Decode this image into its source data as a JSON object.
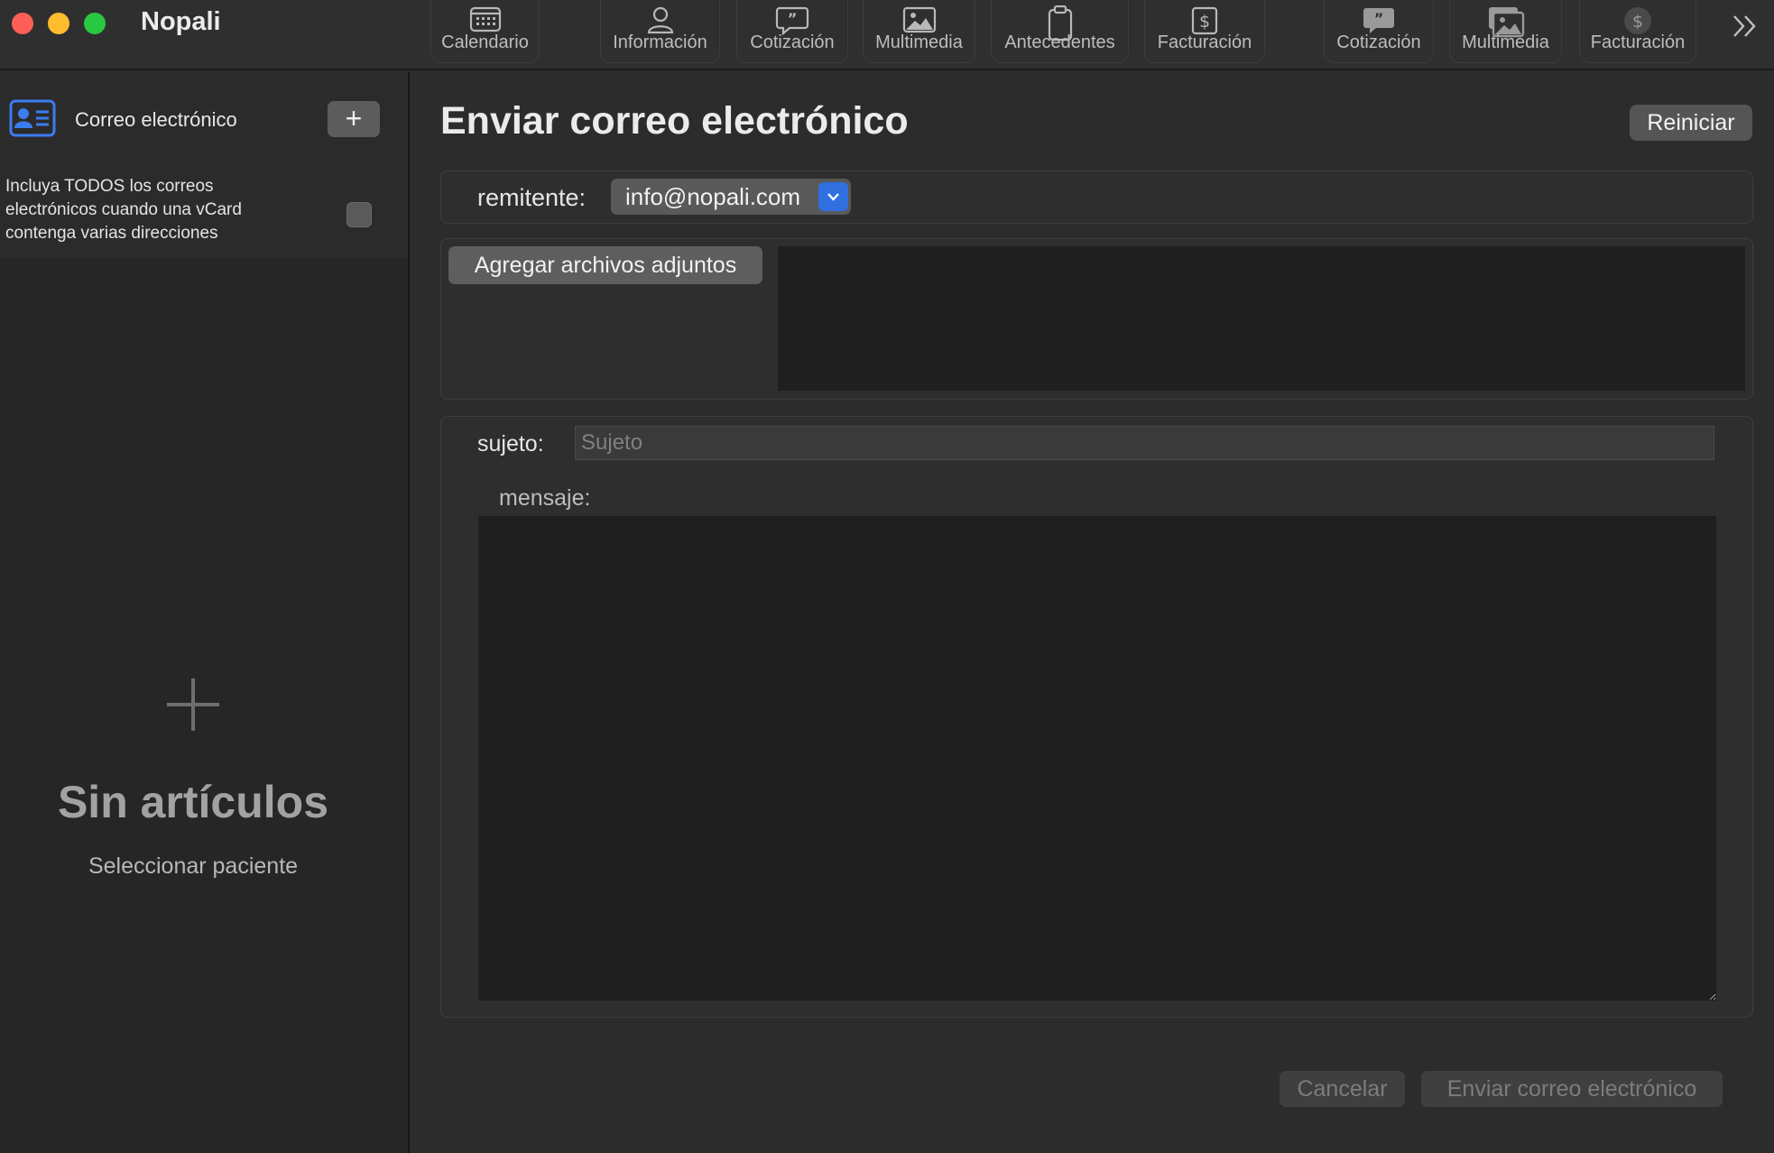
{
  "app": {
    "title": "Nopali"
  },
  "toolbar": {
    "items": [
      {
        "label": "Calendario",
        "icon": "calendar-icon"
      },
      {
        "label": "Información",
        "icon": "person-icon"
      },
      {
        "label": "Cotización",
        "icon": "quote-bubble-icon"
      },
      {
        "label": "Multimedia",
        "icon": "photo-icon"
      },
      {
        "label": "Antecedentes",
        "icon": "clipboard-icon"
      },
      {
        "label": "Facturación",
        "icon": "dollar-document-icon"
      },
      {
        "label": "Cotización",
        "icon": "quote-bubble-icon"
      },
      {
        "label": "Multimedia",
        "icon": "photos-stack-icon"
      },
      {
        "label": "Facturación",
        "icon": "dollar-circle-icon"
      }
    ],
    "overflow_icon": "double-chevron-right-icon"
  },
  "sidebar": {
    "title": "Correo electrónico",
    "add_icon": "plus-icon",
    "include_all_label": "Incluya TODOS los correos electrónicos cuando una vCard contenga varias direcciones",
    "include_all_checked": false,
    "empty_title": "Sin artículos",
    "empty_subtitle": "Seleccionar paciente"
  },
  "main": {
    "title": "Enviar correo electrónico",
    "reset_label": "Reiniciar",
    "sender_label": "remitente:",
    "sender_value": "info@nopali.com",
    "attach_label": "Agregar archivos adjuntos",
    "subject_label": "sujeto:",
    "subject_placeholder": "Sujeto",
    "subject_value": "",
    "message_label": "mensaje:",
    "message_value": "",
    "cancel_label": "Cancelar",
    "send_label": "Enviar correo electrónico"
  },
  "colors": {
    "accent": "#2f6fe0",
    "close": "#fe5f57",
    "minimize": "#febc2e",
    "zoom": "#28c840"
  }
}
